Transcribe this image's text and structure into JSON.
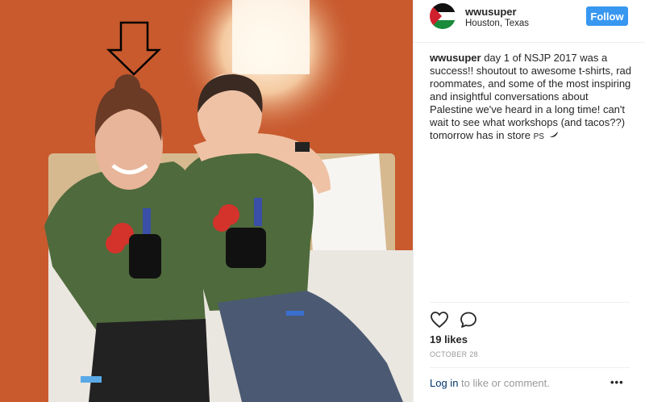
{
  "post": {
    "username": "wwusuper",
    "location": "Houston, Texas",
    "follow_label": "Follow",
    "caption_user": "wwusuper",
    "caption_text": "day 1 of NSJP 2017 was a success!! shoutout to awesome t-shirts, rad roommates, and some of the most inspiring and insightful conversations about Palestine we've heard in a long time! can't wait to see what workshops (and tacos??) tomorrow has in store",
    "caption_emoji": "PS",
    "likes": "19 likes",
    "date": "OCTOBER 28",
    "login_link": "Log in",
    "login_rest": " to like or comment.",
    "more_label": "•••"
  },
  "icons": {
    "like": "heart-icon",
    "comment": "comment-bubble-icon",
    "arrow": "down-arrow-icon",
    "avatar_flag": "palestine-flag"
  },
  "colors": {
    "follow_button": "#3897f0",
    "login_link": "#003569",
    "wall": "#c85a2e",
    "shirt": "#4f6a3c"
  }
}
